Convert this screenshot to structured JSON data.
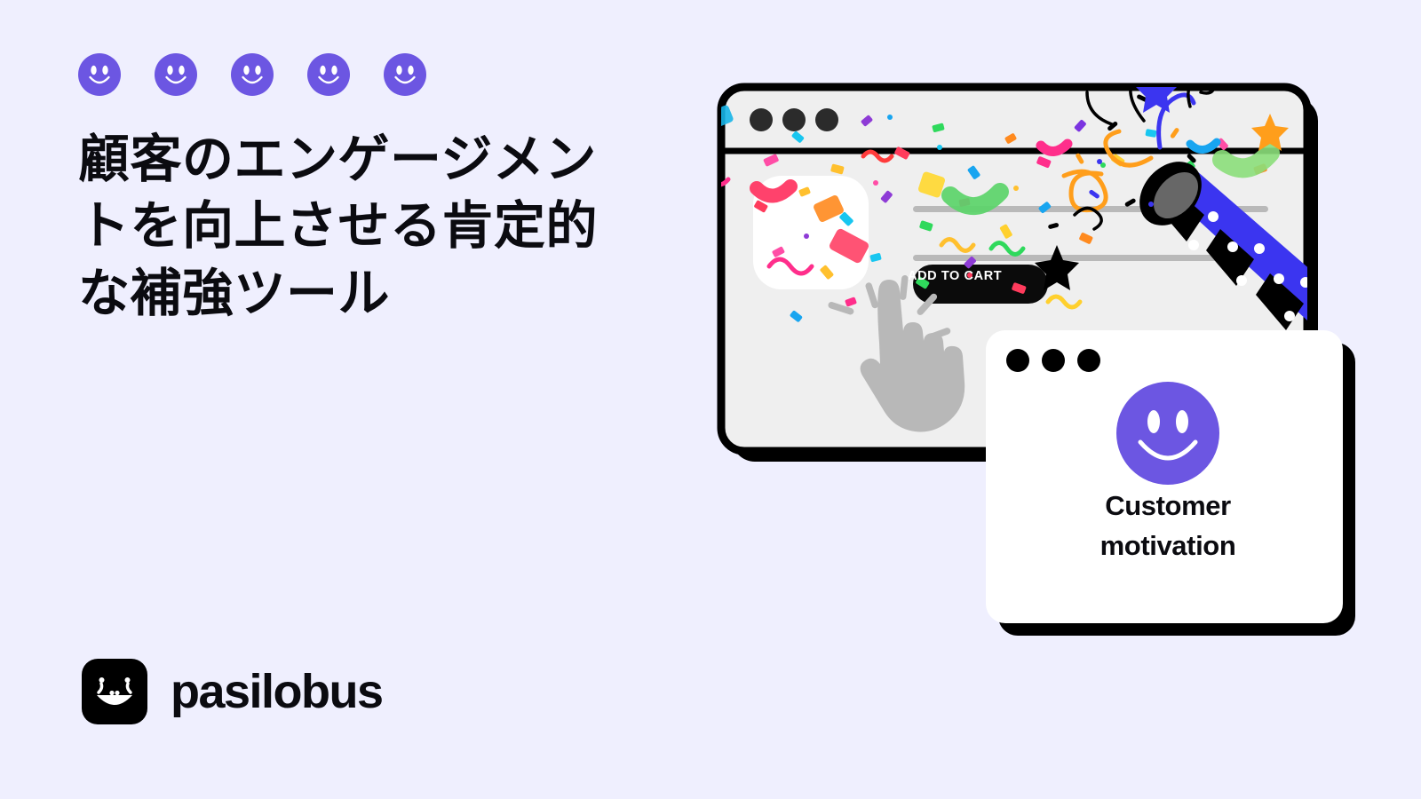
{
  "page": {
    "background_color": "#EFEFFE",
    "accent_purple": "#6C56E2",
    "ink": "#0B0B10",
    "popper_blue": "#3B35F0",
    "window_fill": "#EFEFEF"
  },
  "hero": {
    "rating_icons": [
      {
        "name": "smiley-icon-1",
        "glyph": "smiley-face"
      },
      {
        "name": "smiley-icon-2",
        "glyph": "smiley-face"
      },
      {
        "name": "smiley-icon-3",
        "glyph": "smiley-face"
      },
      {
        "name": "smiley-icon-4",
        "glyph": "smiley-face"
      },
      {
        "name": "smiley-icon-5",
        "glyph": "smiley-face"
      }
    ],
    "headline": "顧客のエンゲージメントを向上させる肯定的な補強ツール"
  },
  "logo": {
    "wordmark": "pasilobus",
    "icon": "laughing-face-icon"
  },
  "illustration": {
    "browser_window": {
      "dots": 3,
      "add_to_cart_label": "ADD TO CART",
      "placeholder_lines": 2,
      "product_thumbnail": "white-rounded-square",
      "cursor": "pointing-hand-click-icon",
      "party_popper": "party-popper-icon",
      "confetti": "multicolor-confetti"
    },
    "motivation_card": {
      "dots": 3,
      "icon": "smiley-face-icon",
      "title_line_1": "Customer",
      "title_line_2": "motivation"
    }
  }
}
